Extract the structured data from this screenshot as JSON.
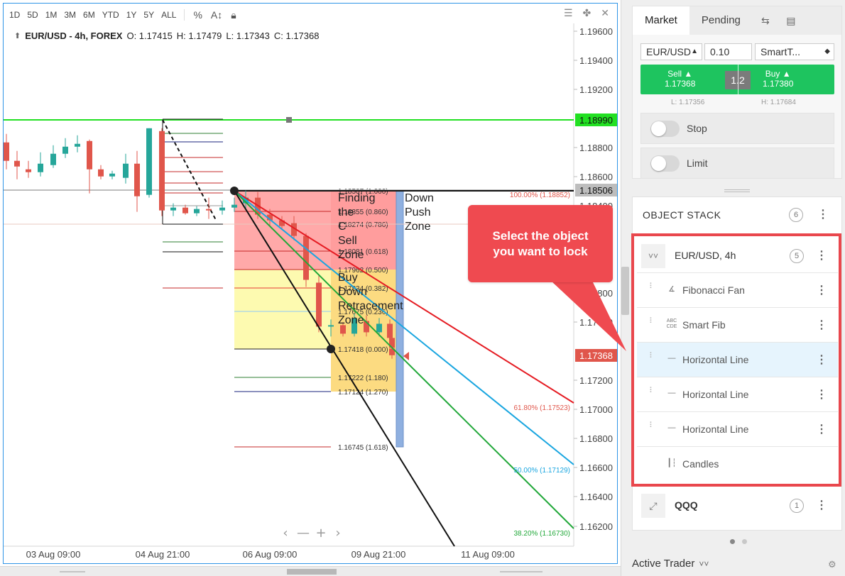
{
  "toolbar": {
    "timeframes": [
      "1D",
      "5D",
      "1M",
      "3M",
      "6M",
      "YTD",
      "1Y",
      "5Y",
      "ALL"
    ],
    "percent_icon": "percent-icon",
    "log_icon": "auto-scale-icon",
    "lock_icon": "lock-icon",
    "menu_icon": "hamburger-icon",
    "layout_icon": "crosshair-icon",
    "close_icon": "close-icon"
  },
  "legend": {
    "symbol": "EUR/USD - 4h, FOREX",
    "open": "O: 1.17415",
    "high": "H: 1.17479",
    "low": "L: 1.17343",
    "close": "C: 1.17368"
  },
  "colors": {
    "bull": "#26a69a",
    "bear": "#e0564b",
    "accent": "#2f95e6",
    "green_line": "#22e022",
    "red": "#e9474d",
    "trade_green": "#1ec45f"
  },
  "chart_data": {
    "type": "candlestick",
    "symbol": "EUR/USD",
    "timeframe": "4h",
    "y_ticks": [
      "1.19600",
      "1.19400",
      "1.19200",
      "1.18800",
      "1.18600",
      "1.18400",
      "1.17800",
      "1.17600",
      "1.17200",
      "1.17000",
      "1.16800",
      "1.16600",
      "1.16400",
      "1.16200"
    ],
    "x_ticks": [
      "03 Aug 09:00",
      "04 Aug 21:00",
      "06 Aug 09:00",
      "09 Aug 21:00",
      "11 Aug 09:00"
    ],
    "ylim": [
      1.1602,
      1.1971
    ],
    "candles": [
      {
        "o": 1.1887,
        "h": 1.1893,
        "l": 1.1868,
        "c": 1.1874
      },
      {
        "o": 1.1874,
        "h": 1.1881,
        "l": 1.1861,
        "c": 1.187
      },
      {
        "o": 1.1868,
        "h": 1.1874,
        "l": 1.1862,
        "c": 1.1866
      },
      {
        "o": 1.1866,
        "h": 1.188,
        "l": 1.1863,
        "c": 1.1872
      },
      {
        "o": 1.1871,
        "h": 1.1885,
        "l": 1.1869,
        "c": 1.1879
      },
      {
        "o": 1.1879,
        "h": 1.189,
        "l": 1.1876,
        "c": 1.1884
      },
      {
        "o": 1.1884,
        "h": 1.1892,
        "l": 1.188,
        "c": 1.1886
      },
      {
        "o": 1.1888,
        "h": 1.1889,
        "l": 1.1851,
        "c": 1.1868
      },
      {
        "o": 1.1868,
        "h": 1.1871,
        "l": 1.1861,
        "c": 1.1863
      },
      {
        "o": 1.1863,
        "h": 1.1867,
        "l": 1.1861,
        "c": 1.1865
      },
      {
        "o": 1.1862,
        "h": 1.1879,
        "l": 1.1858,
        "c": 1.1872
      },
      {
        "o": 1.1872,
        "h": 1.1881,
        "l": 1.1838,
        "c": 1.1849
      },
      {
        "o": 1.185,
        "h": 1.1897,
        "l": 1.1848,
        "c": 1.1897
      },
      {
        "o": 1.1895,
        "h": 1.1897,
        "l": 1.1835,
        "c": 1.1839
      },
      {
        "o": 1.1839,
        "h": 1.1844,
        "l": 1.1835,
        "c": 1.1841
      },
      {
        "o": 1.1841,
        "h": 1.1843,
        "l": 1.1836,
        "c": 1.1837
      },
      {
        "o": 1.1837,
        "h": 1.1842,
        "l": 1.1835,
        "c": 1.184
      },
      {
        "o": 1.184,
        "h": 1.1848,
        "l": 1.1833,
        "c": 1.1839
      },
      {
        "o": 1.1839,
        "h": 1.1846,
        "l": 1.1836,
        "c": 1.1841
      },
      {
        "o": 1.1841,
        "h": 1.1848,
        "l": 1.1838,
        "c": 1.1843
      },
      {
        "o": 1.1844,
        "h": 1.1853,
        "l": 1.1839,
        "c": 1.1848
      },
      {
        "o": 1.1848,
        "h": 1.1852,
        "l": 1.1833,
        "c": 1.1836
      },
      {
        "o": 1.1836,
        "h": 1.184,
        "l": 1.1828,
        "c": 1.1832
      },
      {
        "o": 1.1832,
        "h": 1.1835,
        "l": 1.1826,
        "c": 1.1828
      },
      {
        "o": 1.183,
        "h": 1.1835,
        "l": 1.1818,
        "c": 1.1821
      },
      {
        "o": 1.1821,
        "h": 1.1823,
        "l": 1.1785,
        "c": 1.179
      },
      {
        "o": 1.1788,
        "h": 1.1793,
        "l": 1.1753,
        "c": 1.1757
      },
      {
        "o": 1.1757,
        "h": 1.1762,
        "l": 1.175,
        "c": 1.1758
      },
      {
        "o": 1.1758,
        "h": 1.176,
        "l": 1.175,
        "c": 1.1752
      },
      {
        "o": 1.1752,
        "h": 1.1766,
        "l": 1.175,
        "c": 1.1763
      },
      {
        "o": 1.1761,
        "h": 1.1765,
        "l": 1.175,
        "c": 1.1753
      },
      {
        "o": 1.1753,
        "h": 1.1763,
        "l": 1.175,
        "c": 1.1759
      },
      {
        "o": 1.1759,
        "h": 1.1762,
        "l": 1.1747,
        "c": 1.1749
      },
      {
        "o": 1.1749,
        "h": 1.1752,
        "l": 1.174,
        "c": 1.1742
      },
      {
        "o": 1.17415,
        "h": 1.17479,
        "l": 1.17343,
        "c": 1.17368
      }
    ],
    "price_lines": [
      {
        "label": "1.18990",
        "color": "#22e022"
      },
      {
        "label": "1.18506",
        "color": "#bdbdbd"
      },
      {
        "label": "1.17368",
        "color": "#e0564b"
      }
    ],
    "fib_levels": [
      {
        "label": "1.18507 (1.000)"
      },
      {
        "label": "1.18355 (0.860)"
      },
      {
        "label": "1.18274 (0.786)"
      },
      {
        "label": "1.18081 (0.618)"
      },
      {
        "label": "1.17962 (0.500)"
      },
      {
        "label": "1.17834 (0.382)"
      },
      {
        "label": "1.17675 (0.236)"
      },
      {
        "label": "1.17418 (0.000)"
      },
      {
        "label": "1.17222 (1.180)"
      },
      {
        "label": "1.17124 (1.270)"
      },
      {
        "label": "1.16745 (1.618)"
      }
    ],
    "zone_labels": {
      "sell_zone": "Finding the C Sell Zone",
      "push_zone": "Down Push Zone",
      "buy_zone": "Buy Down Retracement Zone"
    },
    "fan_labels": [
      {
        "label": "100.00% (1.18852)",
        "color": "#e0564b"
      },
      {
        "label": "61.80% (1.17523)",
        "color": "#e0564b"
      },
      {
        "label": "50.00% (1.17129)",
        "color": "#1aa6e0"
      },
      {
        "label": "38.20% (1.16730)",
        "color": "#22a83a"
      }
    ],
    "nav_controls": [
      "‹",
      "—",
      "+",
      "›"
    ]
  },
  "order_panel": {
    "tabs": [
      "Market",
      "Pending"
    ],
    "tab_icons": [
      "transfer-icon",
      "card-icon"
    ],
    "symbol": "EUR/USD",
    "quantity": "0.10",
    "order_type": "SmartT...",
    "sell": {
      "label": "Sell ▲",
      "price": "1.17368"
    },
    "buy": {
      "label": "Buy ▲",
      "price": "1.17380"
    },
    "spread": "1.2",
    "low": "L: 1.17356",
    "high": "H: 1.17684",
    "stop_label": "Stop",
    "limit_label": "Limit"
  },
  "object_stack": {
    "title": "OBJECT STACK",
    "count": "6",
    "group": {
      "title": "EUR/USD, 4h",
      "count": "5"
    },
    "items": [
      {
        "label": "Fibonacci Fan",
        "icon": "fib-fan-icon"
      },
      {
        "label": "Smart Fib",
        "icon": "smart-fib-icon"
      },
      {
        "label": "Horizontal Line",
        "icon": "horizontal-line-icon"
      },
      {
        "label": "Horizontal Line",
        "icon": "horizontal-line-icon"
      },
      {
        "label": "Horizontal Line",
        "icon": "horizontal-line-icon"
      },
      {
        "label": "Candles",
        "icon": "candles-icon"
      }
    ],
    "qqq": {
      "title": "QQQ",
      "count": "1"
    }
  },
  "tooltip": {
    "text_line1": "Select the object",
    "text_line2": "you want to lock"
  },
  "active_trader": {
    "label": "Active Trader"
  }
}
